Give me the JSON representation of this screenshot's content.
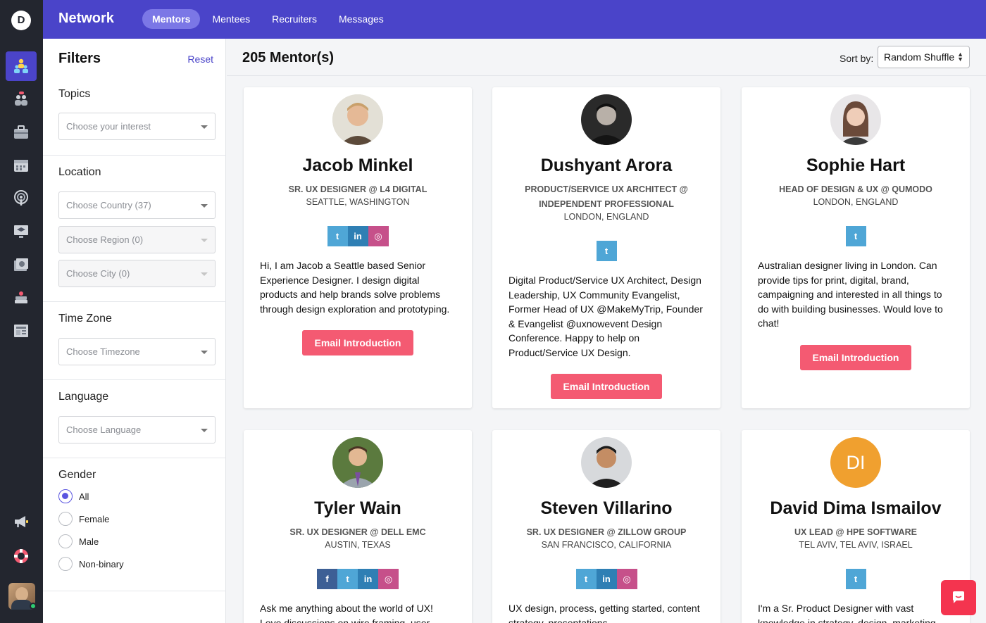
{
  "app": {
    "logo_letter": "D",
    "brand": "Network"
  },
  "nav": {
    "tabs": [
      "Mentors",
      "Mentees",
      "Recruiters",
      "Messages"
    ],
    "active": "Mentors"
  },
  "rail": {
    "icons": [
      "mentors-icon",
      "mentees-icon",
      "jobs-icon",
      "calendar-icon",
      "podcast-icon",
      "learning-icon",
      "photos-icon",
      "books-icon",
      "articles-icon",
      "megaphone-icon",
      "help-icon"
    ]
  },
  "filters": {
    "title": "Filters",
    "reset": "Reset",
    "topics": {
      "label": "Topics",
      "placeholder": "Choose your interest"
    },
    "location": {
      "label": "Location",
      "country": "Choose Country (37)",
      "region": "Choose Region (0)",
      "city": "Choose City (0)"
    },
    "timezone": {
      "label": "Time Zone",
      "placeholder": "Choose Timezone"
    },
    "language": {
      "label": "Language",
      "placeholder": "Choose Language"
    },
    "gender": {
      "label": "Gender",
      "options": [
        "All",
        "Female",
        "Male",
        "Non-binary"
      ],
      "selected": "All"
    }
  },
  "main": {
    "count": "205 Mentor(s)",
    "sort_label": "Sort by:",
    "sort_value": "Random Shuffle"
  },
  "colors": {
    "brand": "#4a44c9",
    "accent_button": "#f45a72",
    "chat": "#f4344f"
  },
  "mentors": [
    {
      "name": "Jacob Minkel",
      "title": "Sr. UX Designer @ L4 Digital",
      "location": "Seattle, Washington",
      "social": [
        "twitter",
        "linkedin",
        "dribbble"
      ],
      "bio": "Hi, I am Jacob a Seattle based Senior Experience Designer. I design digital products and help brands solve problems through design exploration and prototyping.",
      "button": "Email Introduction"
    },
    {
      "name": "Dushyant Arora",
      "title": "Product/Service UX Architect @ Independent Professional",
      "location": "London, England",
      "social": [
        "twitter"
      ],
      "bio": "Digital Product/Service UX Architect, Design Leadership, UX Community Evangelist, Former Head of UX @MakeMyTrip, Founder & Evangelist @uxnowevent Design Conference. Happy to help on Product/Service UX Design.",
      "button": "Email Introduction"
    },
    {
      "name": "Sophie Hart",
      "title": "Head of Design & UX @ Qumodo",
      "location": "London, England",
      "social": [
        "twitter"
      ],
      "bio": "Australian designer living in London. Can provide tips for print, digital, brand, campaigning and interested in all things to do with building businesses. Would love to chat!",
      "button": "Email Introduction"
    },
    {
      "name": "Tyler Wain",
      "title": "Sr. UX Designer @ Dell EMC",
      "location": "Austin, Texas",
      "social": [
        "facebook",
        "twitter",
        "linkedin",
        "dribbble"
      ],
      "bio": "Ask me anything about the world of UX! Love discussions on wire framing, user",
      "button": ""
    },
    {
      "name": "Steven Villarino",
      "title": "Sr. UX Designer @ Zillow Group",
      "location": "San Francisco, California",
      "social": [
        "twitter",
        "linkedin",
        "dribbble"
      ],
      "bio": "UX design, process, getting started, content strategy, presentations",
      "button": ""
    },
    {
      "name": "David Dima Ismailov",
      "initials": "DI",
      "title": "UX Lead @ HPE Software",
      "location": "Tel Aviv, Tel Aviv, Israel",
      "social": [
        "twitter"
      ],
      "bio": "I'm a Sr. Product Designer with vast knowledge in strategy, design, marketing",
      "button": ""
    }
  ]
}
